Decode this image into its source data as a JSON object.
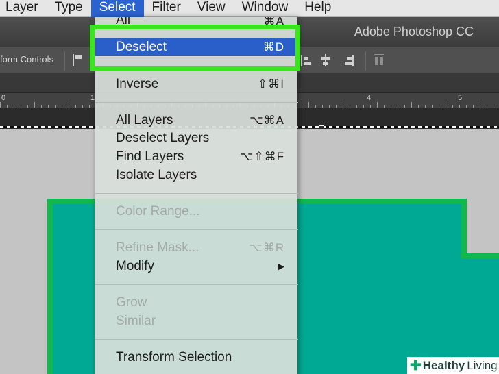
{
  "menubar": {
    "items": [
      "Layer",
      "Type",
      "Select",
      "Filter",
      "View",
      "Window",
      "Help"
    ],
    "active_index": 2
  },
  "window": {
    "title": "Adobe Photoshop CC"
  },
  "options_bar": {
    "label": "form Controls"
  },
  "ruler": {
    "labels": [
      "0",
      "1",
      "4",
      "5"
    ]
  },
  "select_menu": {
    "partial_top_item": {
      "label": "All",
      "shortcut": "⌘A"
    },
    "items": [
      {
        "label": "Deselect",
        "shortcut": "⌘D",
        "highlighted": true,
        "enabled": true
      },
      {
        "label": "Inverse",
        "shortcut": "⇧⌘I",
        "enabled": true
      },
      {
        "label": "All Layers",
        "shortcut": "⌥⌘A",
        "enabled": true
      },
      {
        "label": "Deselect Layers",
        "shortcut": "",
        "enabled": true
      },
      {
        "label": "Find Layers",
        "shortcut": "⌥⇧⌘F",
        "enabled": true
      },
      {
        "label": "Isolate Layers",
        "shortcut": "",
        "enabled": true
      },
      {
        "label": "Color Range...",
        "shortcut": "",
        "enabled": false
      },
      {
        "label": "Refine Mask...",
        "shortcut": "⌥⌘R",
        "enabled": false
      },
      {
        "label": "Modify",
        "shortcut": "▶",
        "enabled": true
      },
      {
        "label": "Grow",
        "shortcut": "",
        "enabled": false
      },
      {
        "label": "Similar",
        "shortcut": "",
        "enabled": false
      },
      {
        "label": "Transform Selection",
        "shortcut": "",
        "enabled": true
      }
    ]
  },
  "watermark": {
    "icon": "healthy-living-cross-icon",
    "text_bold": "Healthy",
    "text_regular": "Living"
  },
  "colors": {
    "menu_highlight": "#2a5fc9",
    "callout_frame": "#39e61d",
    "shape_fill": "#00a994",
    "shape_stroke": "#11b84a"
  }
}
